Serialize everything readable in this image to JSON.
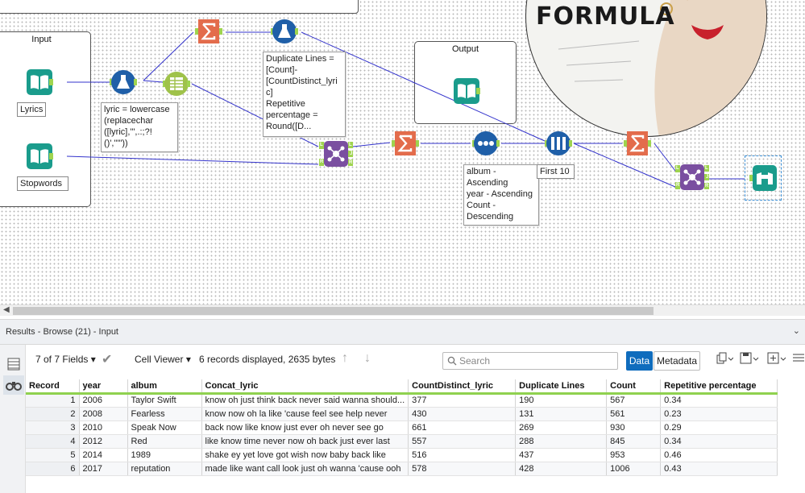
{
  "canvas": {
    "containers": {
      "input_title": "Input",
      "output_title": "Output"
    },
    "labels": {
      "lyrics": "Lyrics",
      "stopwords": "Stopwords",
      "first10": "First 10"
    },
    "annotations": {
      "formula1": [
        "lyric = lowercase",
        "(replacechar",
        "([lyric],'\",.:;?!",
        "()','\"\"))"
      ],
      "formula2": [
        "Duplicate Lines =",
        "[Count]-",
        "[CountDistinct_lyri",
        "c]",
        "Repetitive",
        "percentage =",
        "Round([D..."
      ],
      "sort": [
        "album -",
        "Ascending",
        "year - Ascending",
        "Count -",
        "Descending"
      ]
    },
    "join_ports": [
      "L",
      "J",
      "R"
    ],
    "promo_text": "FORMULA",
    "colors": {
      "input_tool": "#1a9c8c",
      "formula_tool": "#1f5fa8",
      "summarize_tool": "#e36c4c",
      "join_tool": "#7a4fa0",
      "browse_tool": "#1a9c8c",
      "text_to_columns": "#9fc24a",
      "connector": "#3333cc",
      "anchor": "#9fd44f"
    }
  },
  "results": {
    "title": "Results - Browse (21) - Input",
    "fields_selector": "7 of 7 Fields",
    "viewer": "Cell Viewer",
    "summary": "6 records displayed, 2635 bytes",
    "search_placeholder": "Search",
    "data_tab": "Data",
    "metadata_tab": "Metadata",
    "columns": [
      "Record",
      "year",
      "album",
      "Concat_lyric",
      "CountDistinct_lyric",
      "Duplicate Lines",
      "Count",
      "Repetitive percentage"
    ],
    "rows": [
      [
        "1",
        "2006",
        "Taylor Swift",
        "know oh just think back never said wanna should...",
        "377",
        "190",
        "567",
        "0.34"
      ],
      [
        "2",
        "2008",
        "Fearless",
        "know now oh la like 'cause feel see help never",
        "430",
        "131",
        "561",
        "0.23"
      ],
      [
        "3",
        "2010",
        "Speak Now",
        "back now like know just ever oh never see go",
        "661",
        "269",
        "930",
        "0.29"
      ],
      [
        "4",
        "2012",
        "Red",
        "like know time never now oh back just ever last",
        "557",
        "288",
        "845",
        "0.34"
      ],
      [
        "5",
        "2014",
        "1989",
        "shake ey yet love got wish now baby back like",
        "516",
        "437",
        "953",
        "0.46"
      ],
      [
        "6",
        "2017",
        "reputation",
        "made like want call look just oh wanna 'cause ooh",
        "578",
        "428",
        "1006",
        "0.43"
      ]
    ]
  }
}
